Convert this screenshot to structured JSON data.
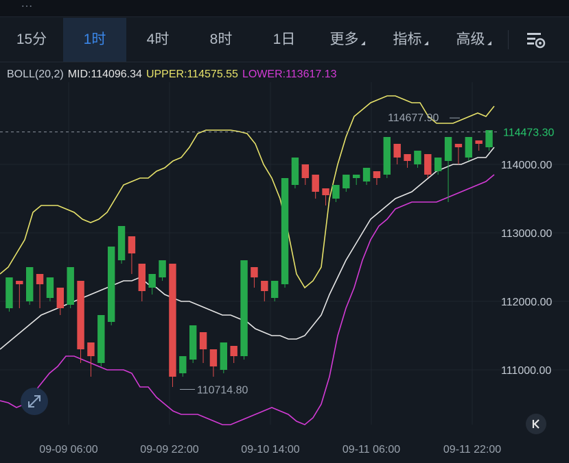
{
  "timeframes": [
    {
      "label": "15分",
      "active": false,
      "dropdown": false
    },
    {
      "label": "1时",
      "active": true,
      "dropdown": false
    },
    {
      "label": "4时",
      "active": false,
      "dropdown": false
    },
    {
      "label": "8时",
      "active": false,
      "dropdown": false
    },
    {
      "label": "1日",
      "active": false,
      "dropdown": false
    },
    {
      "label": "更多",
      "active": false,
      "dropdown": true
    },
    {
      "label": "指标",
      "active": false,
      "dropdown": true
    },
    {
      "label": "高级",
      "active": false,
      "dropdown": true
    }
  ],
  "indicator": {
    "name": "BOLL(20,2)",
    "mid": "MID:114096.34",
    "upper": "UPPER:114575.55",
    "lower": "LOWER:113617.13"
  },
  "colors": {
    "up": "#26a94c",
    "down": "#e24c4c",
    "upper": "#e8e36a",
    "mid": "#e6e6e6",
    "lower": "#d43bd6",
    "active_tab": "#3a86e8",
    "price_tag": "#26c46a"
  },
  "icons": {
    "settings": "chart-settings-icon",
    "expand": "expand-diagonal-icon",
    "jump": "jump-to-latest-icon"
  },
  "chart_data": {
    "type": "candlestick",
    "xlabels": [
      "09-09 06:00",
      "09-09 22:00",
      "09-10 14:00",
      "09-11 06:00",
      "09-11 22:00"
    ],
    "yticks": [
      "114000.00",
      "113000.00",
      "112000.00",
      "111000.00"
    ],
    "ylim": [
      110200,
      115200
    ],
    "last_price": "114473.30",
    "high_label": "114677.90",
    "low_label": "110714.80",
    "upper_band": [
      112400,
      112500,
      112700,
      112900,
      113300,
      113400,
      113400,
      113400,
      113350,
      113300,
      113200,
      113150,
      113200,
      113300,
      113500,
      113700,
      113750,
      113800,
      113800,
      113900,
      113950,
      114050,
      114100,
      114250,
      114450,
      114500,
      114500,
      114500,
      114500,
      114480,
      114450,
      114300,
      114000,
      113800,
      113500,
      113000,
      112400,
      112200,
      112300,
      112500,
      113500,
      114000,
      114400,
      114700,
      114800,
      114900,
      114950,
      115000,
      115000,
      114950,
      114900,
      114900,
      114700,
      114600,
      114600,
      114600,
      114650,
      114700,
      114750,
      114700,
      114850
    ],
    "mid_band": [
      111300,
      111400,
      111500,
      111600,
      111700,
      111800,
      111850,
      111900,
      111950,
      112000,
      112050,
      112100,
      112150,
      112200,
      112250,
      112300,
      112300,
      112350,
      112250,
      112200,
      112100,
      112050,
      112000,
      112000,
      111950,
      111900,
      111850,
      111800,
      111800,
      111750,
      111700,
      111600,
      111550,
      111500,
      111500,
      111450,
      111450,
      111500,
      111650,
      111800,
      112100,
      112350,
      112600,
      112800,
      113000,
      113200,
      113300,
      113400,
      113500,
      113550,
      113600,
      113700,
      113800,
      113900,
      113950,
      114000,
      114000,
      114050,
      114100,
      114100,
      114250
    ],
    "lower_band": [
      110550,
      110520,
      110450,
      110500,
      110650,
      110800,
      110950,
      111050,
      111200,
      111200,
      111150,
      111100,
      111050,
      111000,
      111000,
      111000,
      110950,
      110750,
      110750,
      110600,
      110500,
      110400,
      110350,
      110350,
      110350,
      110300,
      110250,
      110200,
      110200,
      110250,
      110300,
      110350,
      110400,
      110450,
      110400,
      110350,
      110250,
      110200,
      110300,
      110500,
      110900,
      111500,
      111900,
      112200,
      112600,
      112900,
      113100,
      113200,
      113350,
      113400,
      113450,
      113450,
      113450,
      113450,
      113500,
      113550,
      113600,
      113650,
      113700,
      113750,
      113850
    ],
    "candles": [
      [
        111900,
        112350,
        111850,
        112300
      ],
      [
        112300,
        112250,
        111900,
        112000
      ],
      [
        112000,
        112500,
        111950,
        112400
      ],
      [
        112400,
        112250,
        111900,
        112050
      ],
      [
        112050,
        112350,
        112000,
        112200
      ],
      [
        112200,
        111900,
        111800,
        111950
      ],
      [
        111950,
        112500,
        111900,
        112300
      ],
      [
        112300,
        111300,
        111100,
        111400
      ],
      [
        111400,
        111200,
        110900,
        111100
      ],
      [
        111100,
        111800,
        111050,
        111700
      ],
      [
        111700,
        112800,
        111650,
        112600
      ],
      [
        112600,
        113100,
        112550,
        112950
      ],
      [
        112950,
        112700,
        112400,
        112550
      ],
      [
        112550,
        112150,
        112000,
        112200
      ],
      [
        112200,
        112400,
        112100,
        112350
      ],
      [
        112350,
        112600,
        112300,
        112550
      ],
      [
        112550,
        110900,
        110750,
        110950
      ],
      [
        110950,
        111200,
        110900,
        111150
      ],
      [
        111150,
        111650,
        111100,
        111550
      ],
      [
        111550,
        111300,
        111100,
        111300
      ],
      [
        111300,
        111050,
        110900,
        111000
      ],
      [
        111000,
        111400,
        110950,
        111350
      ],
      [
        111350,
        111200,
        111100,
        111200
      ],
      [
        111200,
        112600,
        111150,
        112500
      ],
      [
        112500,
        112350,
        112200,
        112300
      ],
      [
        112300,
        112150,
        112000,
        112050
      ],
      [
        112050,
        112300,
        112000,
        112250
      ],
      [
        112250,
        113800,
        112200,
        113700
      ],
      [
        113700,
        114100,
        113650,
        114000
      ],
      [
        114000,
        113800,
        113700,
        113850
      ],
      [
        113850,
        113600,
        113500,
        113650
      ],
      [
        113650,
        113550,
        113400,
        113500
      ],
      [
        113500,
        113700,
        113450,
        113650
      ],
      [
        113650,
        113850,
        113600,
        113800
      ],
      [
        113800,
        113850,
        113700,
        113750
      ],
      [
        113750,
        113950,
        113700,
        113900
      ],
      [
        113900,
        113800,
        113700,
        113850
      ],
      [
        113850,
        114400,
        113800,
        114300
      ],
      [
        114300,
        114100,
        114000,
        114150
      ],
      [
        114150,
        114050,
        113950,
        114000
      ],
      [
        114000,
        114200,
        113950,
        114150
      ],
      [
        114150,
        113850,
        113800,
        113900
      ],
      [
        113900,
        114100,
        113850,
        114050
      ],
      [
        114050,
        114400,
        113450,
        114300
      ],
      [
        114300,
        114250,
        114000,
        114100
      ],
      [
        114100,
        114400,
        114050,
        114350
      ],
      [
        114350,
        114300,
        114200,
        114250
      ],
      [
        114250,
        114500,
        114200,
        114473
      ]
    ]
  }
}
